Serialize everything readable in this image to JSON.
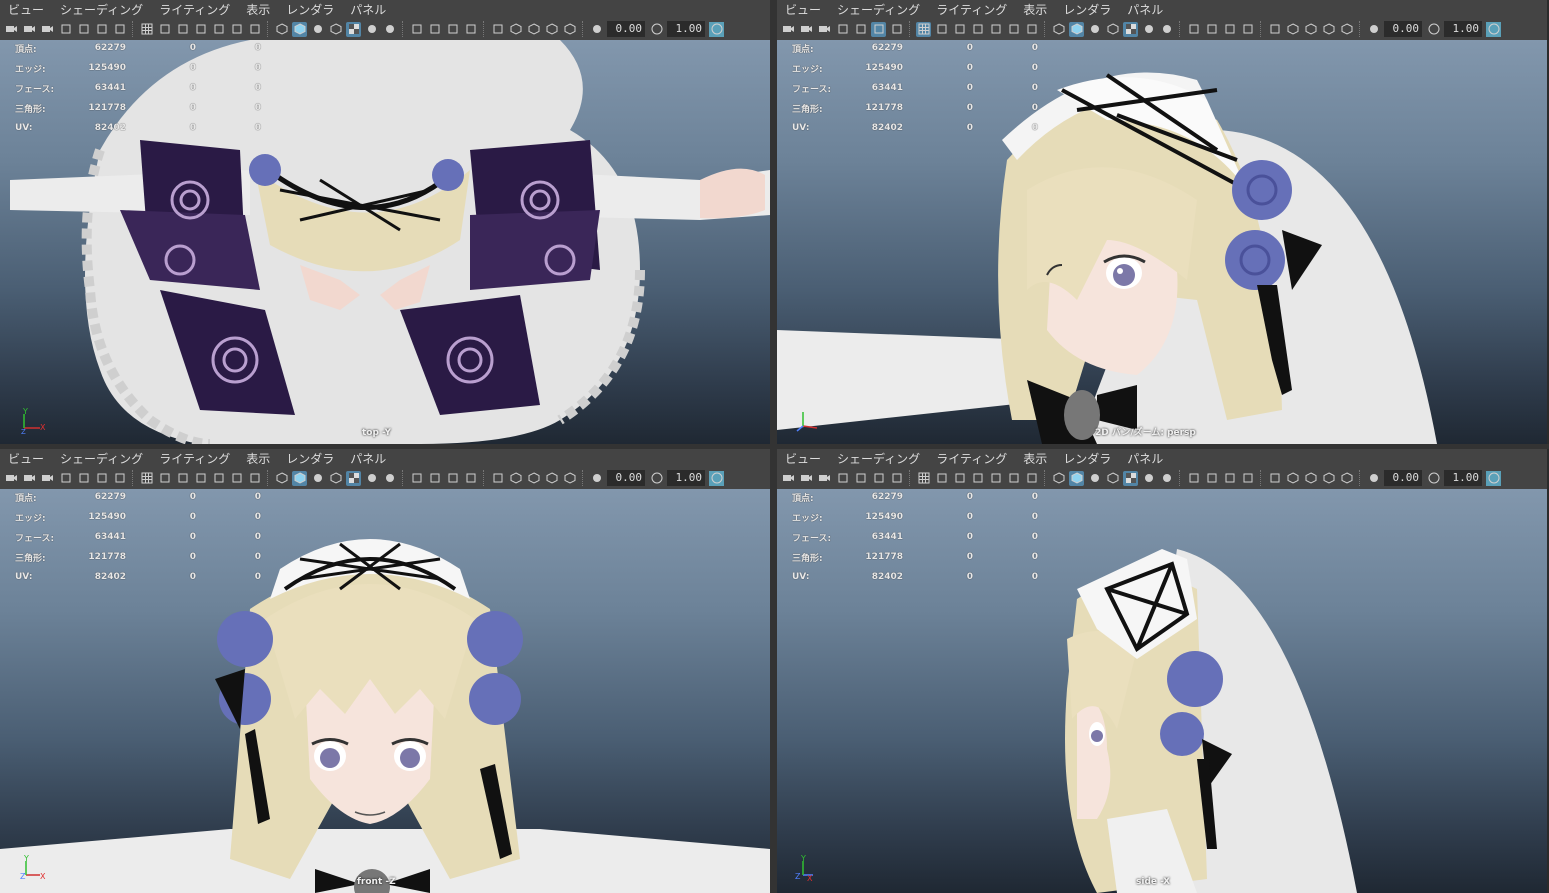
{
  "menu": [
    "ビュー",
    "シェーディング",
    "ライティング",
    "表示",
    "レンダラ",
    "パネル"
  ],
  "toolbar": {
    "field_a": "0.00",
    "field_b": "1.00",
    "colors": {
      "active": "#5285a6",
      "icon": "#cfcfcf"
    }
  },
  "hud": {
    "rows": [
      {
        "label": "頂点:",
        "v1": "62279",
        "v2": "0",
        "v3": "0"
      },
      {
        "label": "エッジ:",
        "v1": "125490",
        "v2": "0",
        "v3": "0"
      },
      {
        "label": "フェース:",
        "v1": "63441",
        "v2": "0",
        "v3": "0"
      },
      {
        "label": "三角形:",
        "v1": "121778",
        "v2": "0",
        "v3": "0"
      },
      {
        "label": "UV:",
        "v1": "82402",
        "v2": "0",
        "v3": "0"
      }
    ]
  },
  "panes": [
    {
      "camera": "top -Y",
      "axis": [
        "Y",
        "X",
        "Z"
      ]
    },
    {
      "camera": "2D パン/ズーム: persp",
      "axis": [
        "Y",
        "Z",
        "X"
      ]
    },
    {
      "camera": "front -Z",
      "axis": [
        "Y",
        "Z",
        "X"
      ]
    },
    {
      "camera": "side -X",
      "axis": [
        "Y",
        "Z",
        "X"
      ]
    }
  ],
  "colors": {
    "viewport_top": "#8297ad",
    "viewport_bottom": "#1f2833",
    "hair": "#e6dcb8",
    "rose": "#6670b8",
    "dress_dark": "#2a1a45",
    "ribbon": "#111111"
  }
}
